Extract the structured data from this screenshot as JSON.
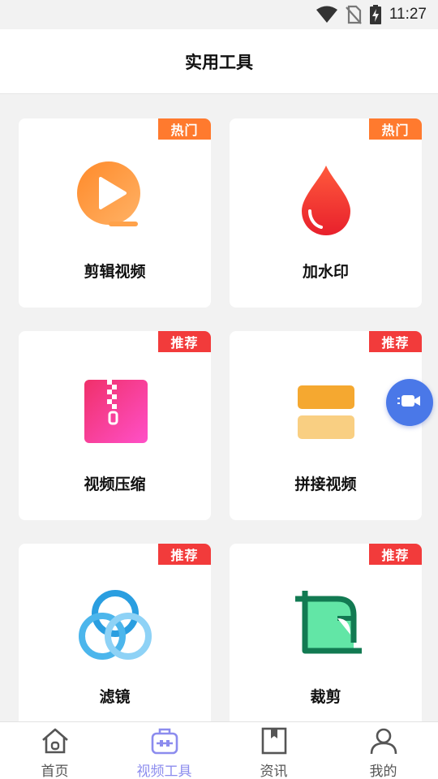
{
  "status_bar": {
    "time": "11:27",
    "icons": [
      "wifi-icon",
      "no-sim-icon",
      "battery-charging-icon"
    ]
  },
  "header": {
    "title": "实用工具"
  },
  "tools": [
    {
      "label": "剪辑视频",
      "badge": "热门",
      "badge_type": "hot",
      "icon": "video-play-icon"
    },
    {
      "label": "加水印",
      "badge": "热门",
      "badge_type": "hot",
      "icon": "water-drop-icon"
    },
    {
      "label": "视频压缩",
      "badge": "推荐",
      "badge_type": "rec",
      "icon": "zip-file-icon"
    },
    {
      "label": "拼接视频",
      "badge": "推荐",
      "badge_type": "rec",
      "icon": "stacked-bars-icon"
    },
    {
      "label": "滤镜",
      "badge": "推荐",
      "badge_type": "rec",
      "icon": "three-circles-icon"
    },
    {
      "label": "裁剪",
      "badge": "推荐",
      "badge_type": "rec",
      "icon": "crop-icon"
    }
  ],
  "floating_button": {
    "icon": "video-camera-icon"
  },
  "tabbar": {
    "items": [
      {
        "label": "首页",
        "icon": "home-icon",
        "active": false
      },
      {
        "label": "视频工具",
        "icon": "toolbox-icon",
        "active": true
      },
      {
        "label": "资讯",
        "icon": "bookmark-book-icon",
        "active": false
      },
      {
        "label": "我的",
        "icon": "person-icon",
        "active": false
      }
    ]
  },
  "colors": {
    "hot_badge": "#ff7a2e",
    "recommend_badge": "#f23b3b",
    "active_tab": "#8c8cee",
    "background": "#f2f2f2"
  }
}
